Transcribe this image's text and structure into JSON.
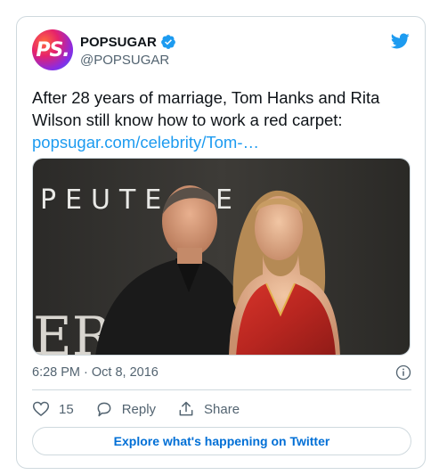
{
  "header": {
    "avatar_text": "PS.",
    "display_name": "POPSUGAR",
    "handle": "@POPSUGAR"
  },
  "tweet": {
    "text": "After 28 years of marriage, Tom Hanks and Rita Wilson still know how to work a red carpet:",
    "link_text": "popsugar.com/celebrity/Tom-…"
  },
  "media": {
    "backdrop_text": "PEUTE",
    "backdrop_text_2": "ER"
  },
  "meta": {
    "timestamp": "6:28 PM · Oct 8, 2016"
  },
  "actions": {
    "like_count": "15",
    "reply_label": "Reply",
    "share_label": "Share"
  },
  "footer": {
    "explore_label": "Explore what's happening on Twitter"
  },
  "colors": {
    "link": "#1d9bf0",
    "muted": "#536471",
    "border": "#cfd9de",
    "button_text": "#006fd6"
  },
  "icons": [
    "verified-badge-icon",
    "twitter-bird-icon",
    "info-icon",
    "heart-icon",
    "reply-bubble-icon",
    "share-icon"
  ]
}
